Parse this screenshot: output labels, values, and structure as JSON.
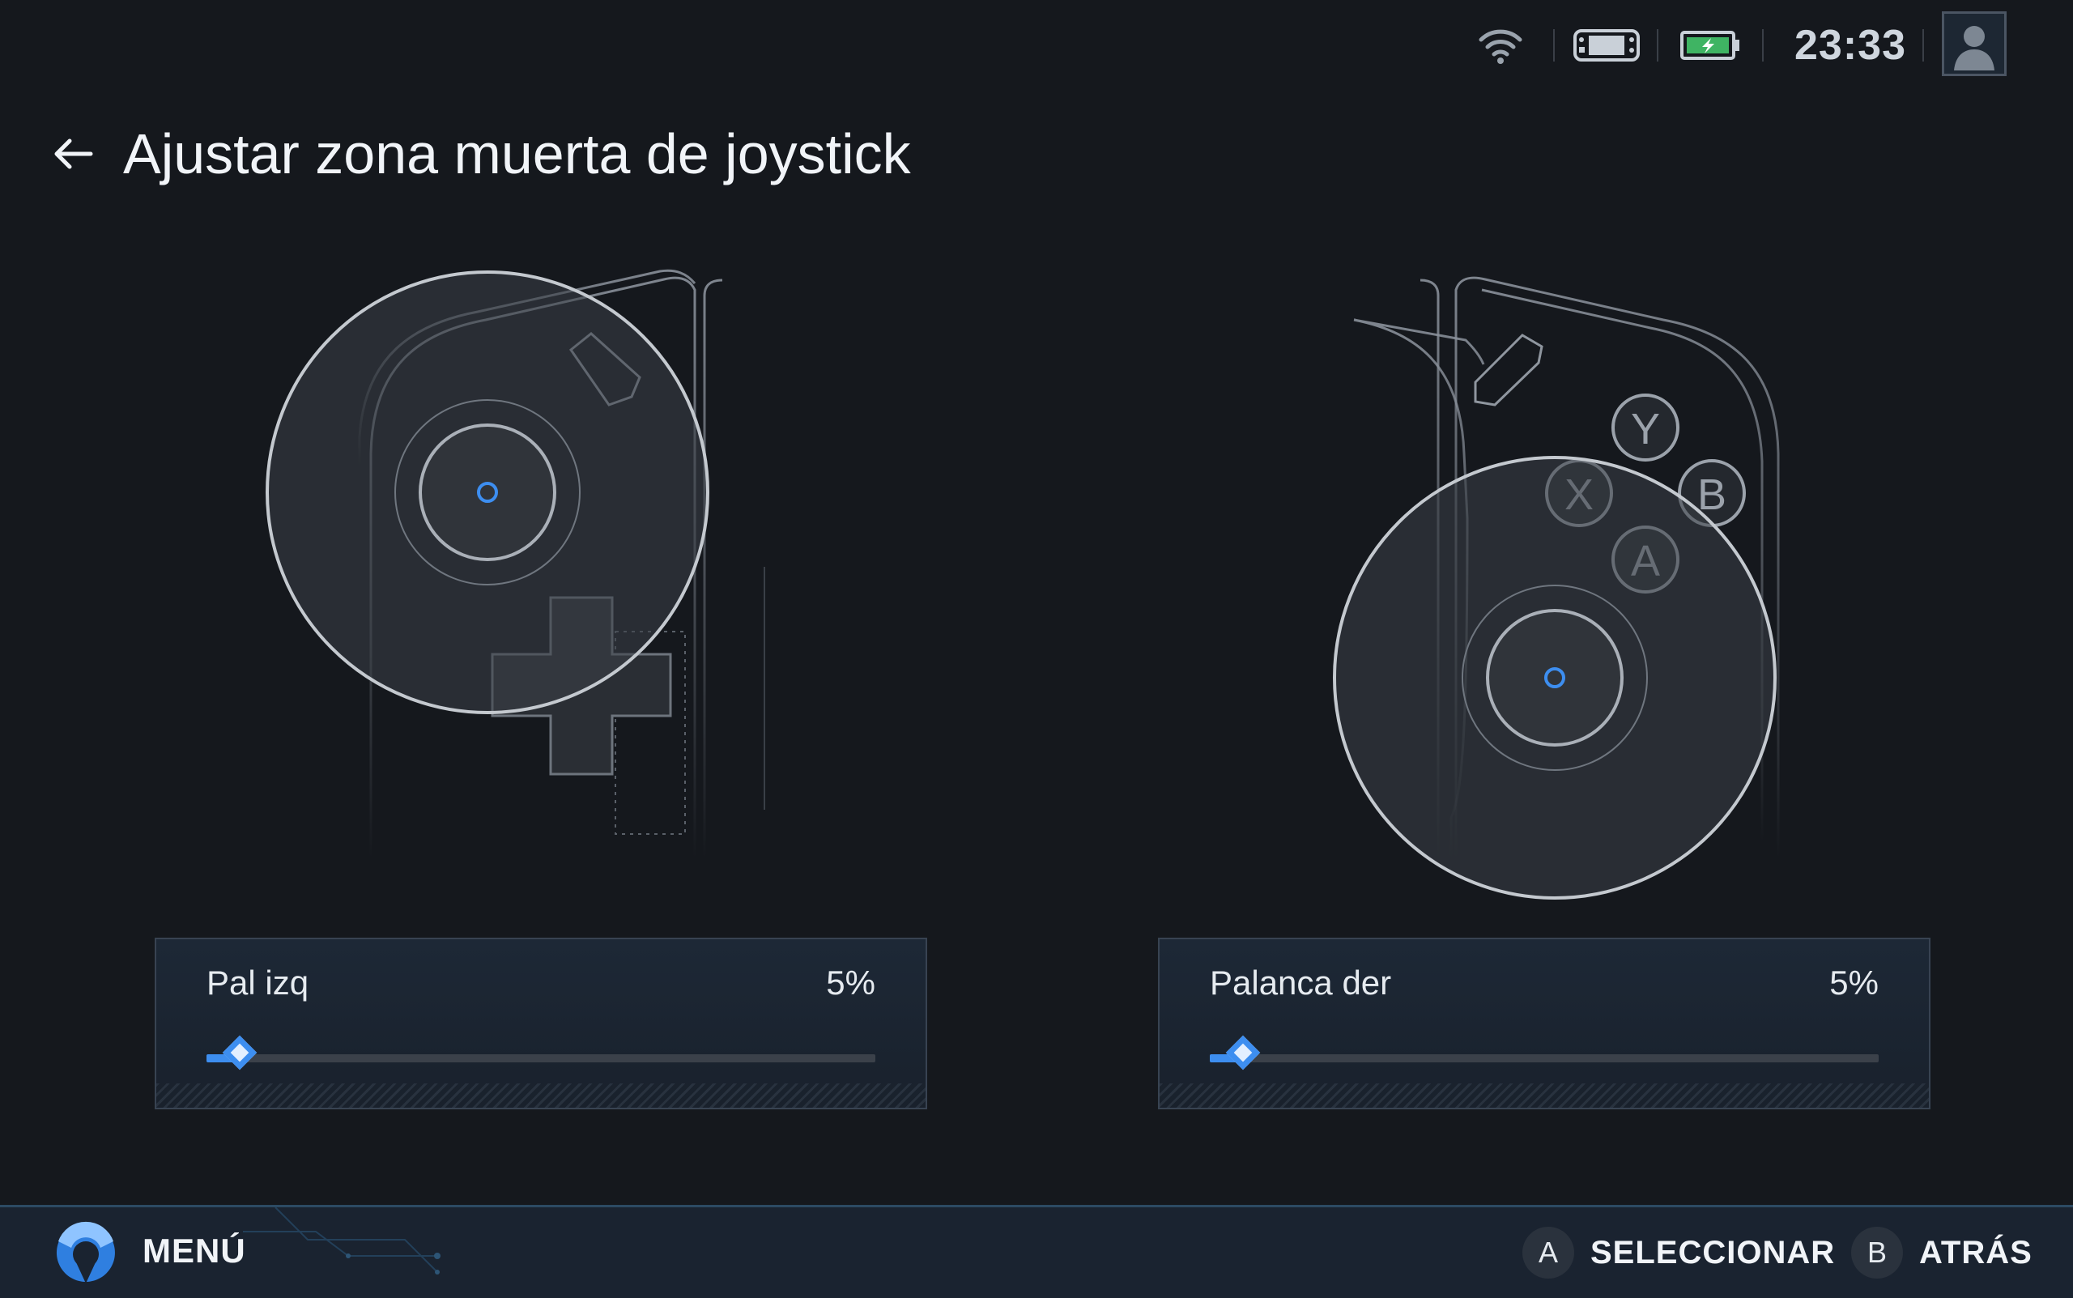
{
  "status_bar": {
    "time": "23:33",
    "icons": [
      "wifi-icon",
      "handheld-device-icon",
      "battery-charging-icon",
      "user-avatar-icon"
    ]
  },
  "header": {
    "title": "Ajustar zona muerta de joystick",
    "back_icon": "arrow-left-icon"
  },
  "illustration": {
    "face_buttons": [
      "Y",
      "X",
      "B",
      "A"
    ]
  },
  "sliders": [
    {
      "label": "Pal izq",
      "value_text": "5%",
      "value": 0.05
    },
    {
      "label": "Palanca der",
      "value_text": "5%",
      "value": 0.05
    }
  ],
  "footer": {
    "menu_label": "MENÚ",
    "hints": [
      {
        "button": "A",
        "label": "SELECCIONAR"
      },
      {
        "button": "B",
        "label": "ATRÁS"
      }
    ]
  },
  "colors": {
    "accent": "#3d8ef0",
    "background": "#15181d",
    "footer": "#1a2330"
  }
}
